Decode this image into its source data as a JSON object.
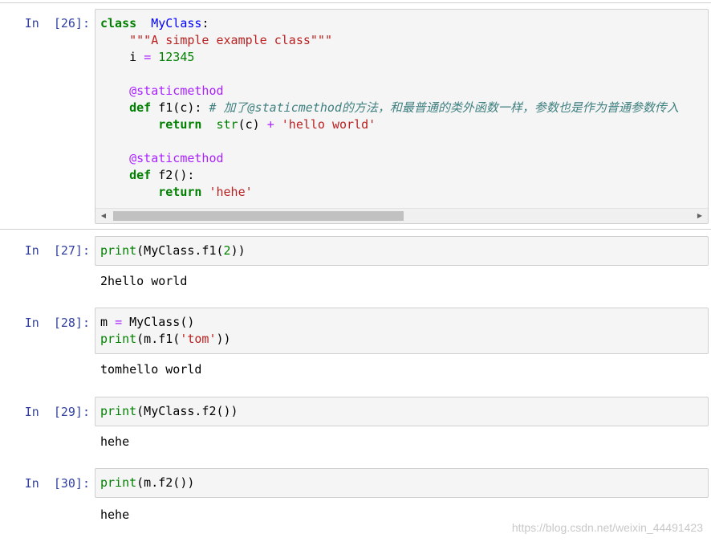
{
  "cells": [
    {
      "prompt": "In  [26]:",
      "lines": [
        [
          [
            "kw",
            "class"
          ],
          [
            "",
            "  "
          ],
          [
            "cls",
            "MyClass"
          ],
          [
            "",
            ":"
          ]
        ],
        [
          [
            "",
            "    "
          ],
          [
            "str",
            "\"\"\"A simple example class\"\"\""
          ]
        ],
        [
          [
            "",
            "    i "
          ],
          [
            "op",
            "="
          ],
          [
            "",
            ""
          ],
          [
            "num",
            " 12345"
          ]
        ],
        [
          [
            "",
            ""
          ]
        ],
        [
          [
            "",
            "    "
          ],
          [
            "dec",
            "@staticmethod"
          ]
        ],
        [
          [
            "",
            "    "
          ],
          [
            "kw",
            "def"
          ],
          [
            "",
            " f1(c): "
          ],
          [
            "cm",
            "# 加了@staticmethod的方法，和最普通的类外函数一样，参数也是作为普通参数传入"
          ]
        ],
        [
          [
            "",
            "        "
          ],
          [
            "kw",
            "return"
          ],
          [
            "",
            "  "
          ],
          [
            "bi",
            "str"
          ],
          [
            "",
            "(c) "
          ],
          [
            "op",
            "+"
          ],
          [
            "",
            ""
          ],
          [
            "str",
            " 'hello world'"
          ]
        ],
        [
          [
            "",
            ""
          ]
        ],
        [
          [
            "",
            "    "
          ],
          [
            "dec",
            "@staticmethod"
          ]
        ],
        [
          [
            "",
            "    "
          ],
          [
            "kw",
            "def"
          ],
          [
            "",
            " f2():"
          ]
        ],
        [
          [
            "",
            "        "
          ],
          [
            "kw",
            "return"
          ],
          [
            "",
            ""
          ],
          [
            "str",
            " 'hehe'"
          ]
        ]
      ],
      "output": ""
    },
    {
      "prompt": "In  [27]:",
      "lines": [
        [
          [
            "bi",
            "print"
          ],
          [
            "",
            "(MyClass.f1("
          ],
          [
            "num",
            "2"
          ],
          [
            "",
            "))"
          ]
        ]
      ],
      "output": "2hello world"
    },
    {
      "prompt": "In  [28]:",
      "lines": [
        [
          [
            "",
            "m "
          ],
          [
            "op",
            "="
          ],
          [
            "",
            " MyClass()"
          ]
        ],
        [
          [
            "bi",
            "print"
          ],
          [
            "",
            "(m.f1("
          ],
          [
            "str",
            "'tom'"
          ],
          [
            "",
            "))"
          ]
        ]
      ],
      "output": "tomhello world"
    },
    {
      "prompt": "In  [29]:",
      "lines": [
        [
          [
            "bi",
            "print"
          ],
          [
            "",
            "(MyClass.f2())"
          ]
        ]
      ],
      "output": "hehe"
    },
    {
      "prompt": "In  [30]:",
      "lines": [
        [
          [
            "bi",
            "print"
          ],
          [
            "",
            "(m.f2())"
          ]
        ]
      ],
      "output": "hehe"
    }
  ],
  "scrollbar": {
    "left_arrow": "◀",
    "right_arrow": "▶",
    "left_icon": "scroll-left-arrow-icon",
    "right_icon": "scroll-right-arrow-icon"
  },
  "watermark": "https://blog.csdn.net/weixin_44491423",
  "colors": {
    "keyword": "#008000",
    "string": "#ba2121",
    "decorator": "#aa22ff",
    "comment": "#408080",
    "prompt": "#303f9f",
    "class_name": "#0000ff"
  }
}
